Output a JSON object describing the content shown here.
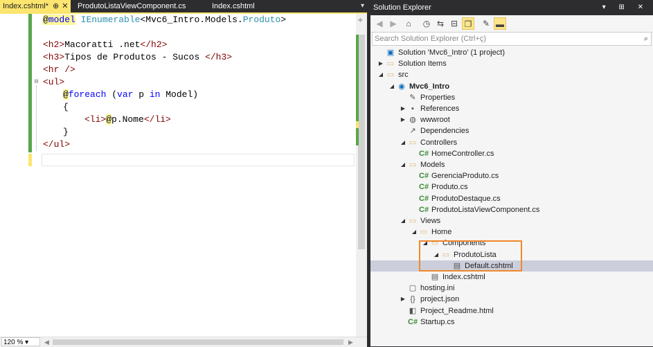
{
  "editor": {
    "tabs": [
      {
        "label": "Index.cshtml*",
        "pin": "⊕",
        "close": "✕",
        "active": true
      },
      {
        "label": "ProdutoListaViewComponent.cs"
      },
      {
        "label": "Index.cshtml"
      }
    ],
    "tab_menu": "▾",
    "zoom": "120 %",
    "code": {
      "l1_at": "@",
      "l1_model": "model",
      "l1_type": "IEnumerable",
      "l1_lt": "<",
      "l1_ns": "Mvc6_Intro.Models.",
      "l1_cls": "Produto",
      "l1_gt": ">",
      "l3_open": "<h2>",
      "l3_text": "Macoratti .net",
      "l3_close": "</h2>",
      "l4_open": "<h3>",
      "l4_text": "Tipos de Produtos - Sucos ",
      "l4_close": "</h3>",
      "l5": "<hr />",
      "l6": "<ul>",
      "l7_at": "@",
      "l7_kw": "foreach",
      "l7_paren": " (",
      "l7_var": "var",
      "l7_p": " p ",
      "l7_in": "in",
      "l7_model": " Model)",
      "l8": "{",
      "l9_open": "<li>",
      "l9_at": "@",
      "l9_p": "p.Nome",
      "l9_close": "</li>",
      "l10": "}",
      "l11": "</ul>"
    }
  },
  "solution_explorer": {
    "title": "Solution Explorer",
    "title_buttons": "▾ ⊞ ✕",
    "search_placeholder": "Search Solution Explorer (Ctrl+ç)",
    "search_icon": "⌕",
    "toolbar_icons": [
      "back-icon",
      "forward-icon",
      "home-icon",
      "history-icon",
      "sync-icon",
      "collapse-all-icon",
      "show-all-files-icon",
      "properties-wrench-icon",
      "preview-icon"
    ],
    "tree": [
      {
        "label": "Solution 'Mvc6_Intro' (1 project)",
        "icon": "solution-icon",
        "indent": 0,
        "expander": ""
      },
      {
        "label": "Solution Items",
        "icon": "folder-icon",
        "indent": 0,
        "expander": "▶"
      },
      {
        "label": "src",
        "icon": "folder-icon",
        "indent": 0,
        "expander": "◢"
      },
      {
        "label": "Mvc6_Intro",
        "icon": "web-project-icon",
        "indent": 1,
        "expander": "◢",
        "bold": true
      },
      {
        "label": "Properties",
        "icon": "wrench-icon",
        "indent": 2,
        "expander": ""
      },
      {
        "label": "References",
        "icon": "references-icon",
        "indent": 2,
        "expander": "▶"
      },
      {
        "label": "wwwroot",
        "icon": "globe-icon",
        "indent": 2,
        "expander": "▶"
      },
      {
        "label": "Dependencies",
        "icon": "dependencies-icon",
        "indent": 2,
        "expander": ""
      },
      {
        "label": "Controllers",
        "icon": "folder-icon",
        "indent": 2,
        "expander": "◢"
      },
      {
        "label": "HomeController.cs",
        "icon": "csharp-file-icon",
        "indent": 3,
        "expander": ""
      },
      {
        "label": "Models",
        "icon": "folder-icon",
        "indent": 2,
        "expander": "◢"
      },
      {
        "label": "GerenciaProduto.cs",
        "icon": "csharp-file-icon",
        "indent": 3,
        "expander": ""
      },
      {
        "label": "Produto.cs",
        "icon": "csharp-file-icon",
        "indent": 3,
        "expander": ""
      },
      {
        "label": "ProdutoDestaque.cs",
        "icon": "csharp-file-icon",
        "indent": 3,
        "expander": ""
      },
      {
        "label": "ProdutoListaViewComponent.cs",
        "icon": "csharp-file-icon",
        "indent": 3,
        "expander": ""
      },
      {
        "label": "Views",
        "icon": "folder-icon",
        "indent": 2,
        "expander": "◢"
      },
      {
        "label": "Home",
        "icon": "folder-icon",
        "indent": 3,
        "expander": "◢"
      },
      {
        "label": "Components",
        "icon": "folder-icon",
        "indent": 4,
        "expander": "◢"
      },
      {
        "label": "ProdutoLista",
        "icon": "folder-icon",
        "indent": 5,
        "expander": "◢"
      },
      {
        "label": "Default.cshtml",
        "icon": "razor-file-icon",
        "indent": 6,
        "expander": "",
        "selected": true
      },
      {
        "label": "Index.cshtml",
        "icon": "razor-file-icon",
        "indent": 4,
        "expander": ""
      },
      {
        "label": "hosting.ini",
        "icon": "config-file-icon",
        "indent": 2,
        "expander": ""
      },
      {
        "label": "project.json",
        "icon": "json-file-icon",
        "indent": 2,
        "expander": "▶"
      },
      {
        "label": "Project_Readme.html",
        "icon": "html-file-icon",
        "indent": 2,
        "expander": ""
      },
      {
        "label": "Startup.cs",
        "icon": "csharp-file-icon",
        "indent": 2,
        "expander": ""
      }
    ]
  },
  "colors": {
    "highlight_box": "#f0882a",
    "active_tab": "#fbe56f",
    "razor_bg": "#fff79a",
    "selected_row": "#cccedb"
  }
}
